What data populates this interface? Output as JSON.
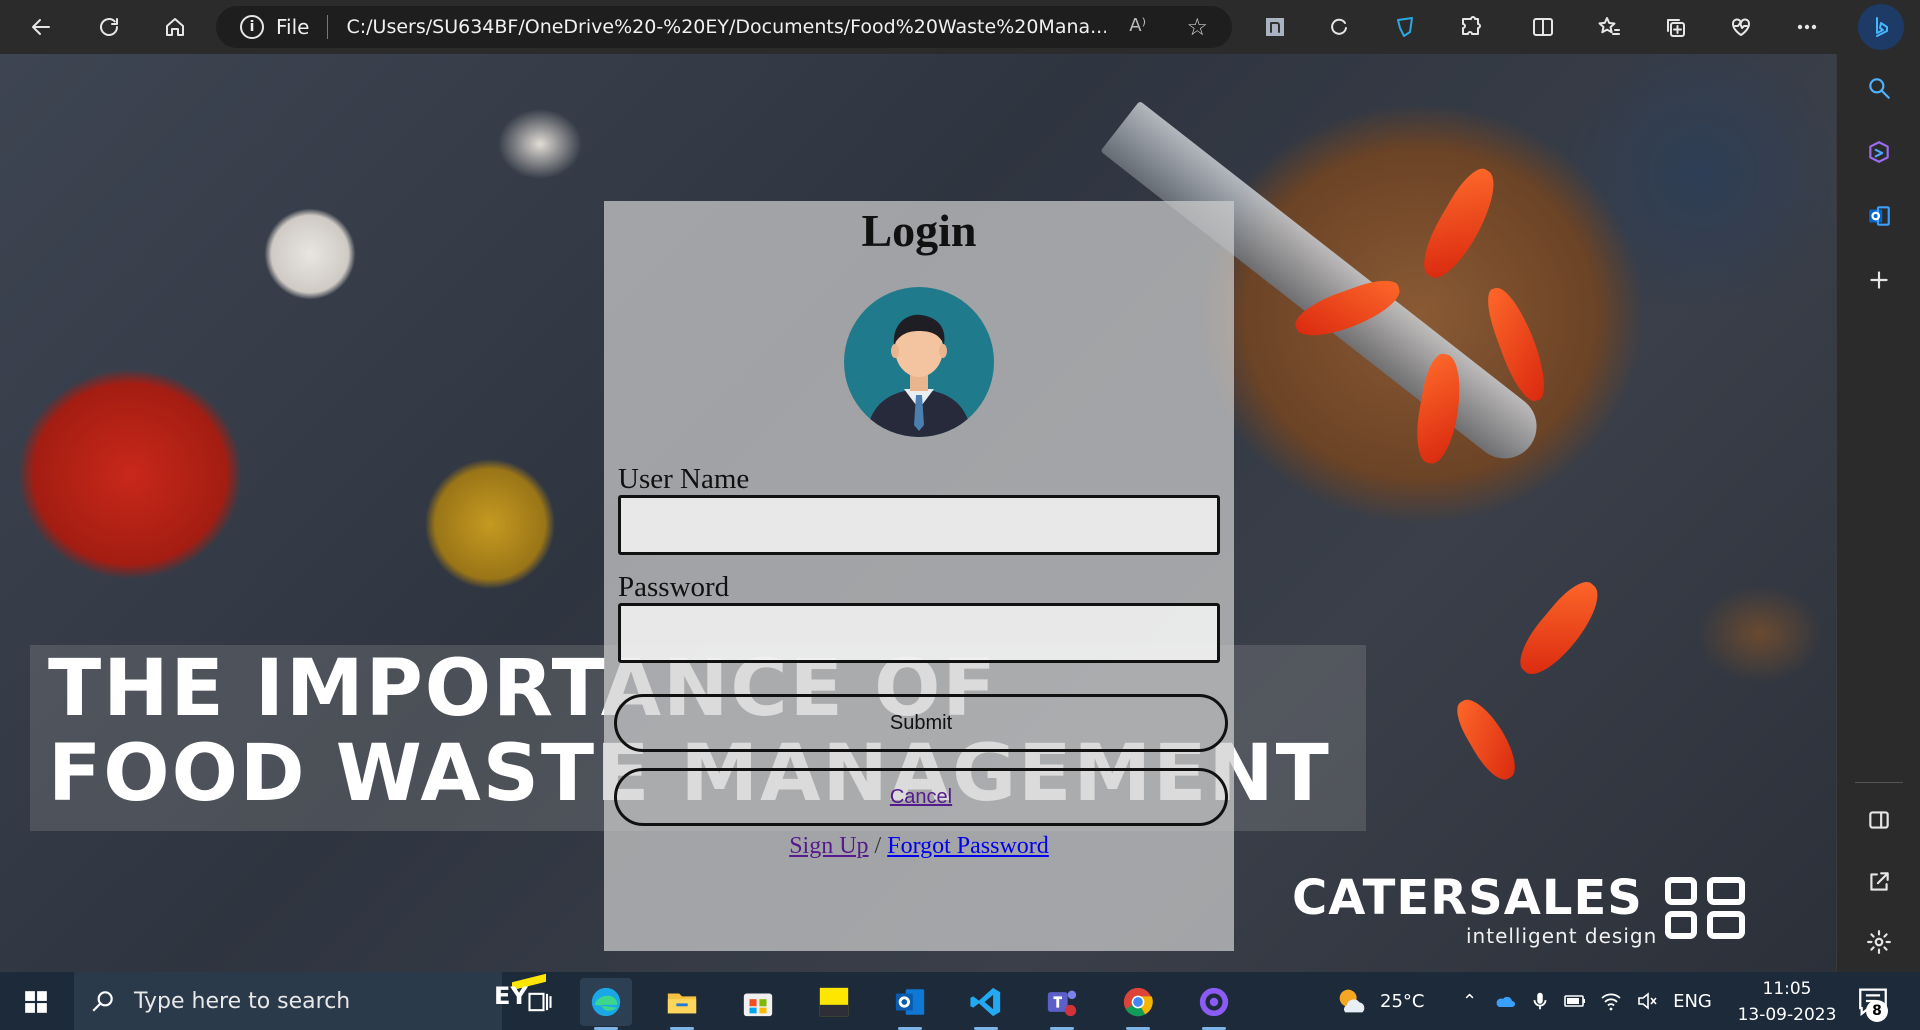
{
  "browser": {
    "address_prefix": "File",
    "url": "C:/Users/SU634BF/OneDrive%20-%20EY/Documents/Food%20Waste%20Mana...",
    "read_aloud": "A⁾"
  },
  "page": {
    "banner_line1": "THE IMPORTANCE OF",
    "banner_line2": "FOOD WASTE MANAGEMENT",
    "brand_name": "CATERSALES",
    "brand_tagline": "intelligent design"
  },
  "login": {
    "title": "Login",
    "username_label": "User Name",
    "username_value": "",
    "password_label": "Password",
    "password_value": "",
    "submit_label": "Submit",
    "cancel_label": "Cancel",
    "signup_label": "Sign Up",
    "link_separator": " / ",
    "forgot_label": "Forgot Password"
  },
  "taskbar": {
    "search_placeholder": "Type here to search",
    "search_logo": "EY",
    "weather_temp": "25°C",
    "language": "ENG",
    "time": "11:05",
    "date": "13-09-2023",
    "notification_count": "8"
  },
  "icons": {
    "toolbar": [
      "back-icon",
      "refresh-icon",
      "home-icon",
      "info-icon",
      "read-aloud-icon",
      "favorite-star-icon",
      "extension-n-icon",
      "circle-extension-icon",
      "shield-extension-icon",
      "puzzle-extensions-icon",
      "split-screen-icon",
      "favorites-icon",
      "collections-icon",
      "browser-essentials-icon",
      "more-icon",
      "bing-icon"
    ],
    "sidebar": [
      "sidebar-search-icon",
      "copilot-icon",
      "outlook-icon",
      "add-icon",
      "hide-sidebar-icon",
      "external-link-icon",
      "settings-icon"
    ],
    "taskbar_apps": [
      "task-view-icon",
      "edge-icon",
      "file-explorer-icon",
      "microsoft-store-icon",
      "ey-discover-icon",
      "outlook-app-icon",
      "vscode-icon",
      "teams-icon",
      "chrome-icon",
      "github-desktop-icon"
    ]
  },
  "colors": {
    "browser_chrome": "#2b2b2b",
    "taskbar": "#1c2a3a",
    "avatar_bg": "#1f7a8c",
    "visited_link": "#551a8b",
    "link": "#0000ee"
  }
}
